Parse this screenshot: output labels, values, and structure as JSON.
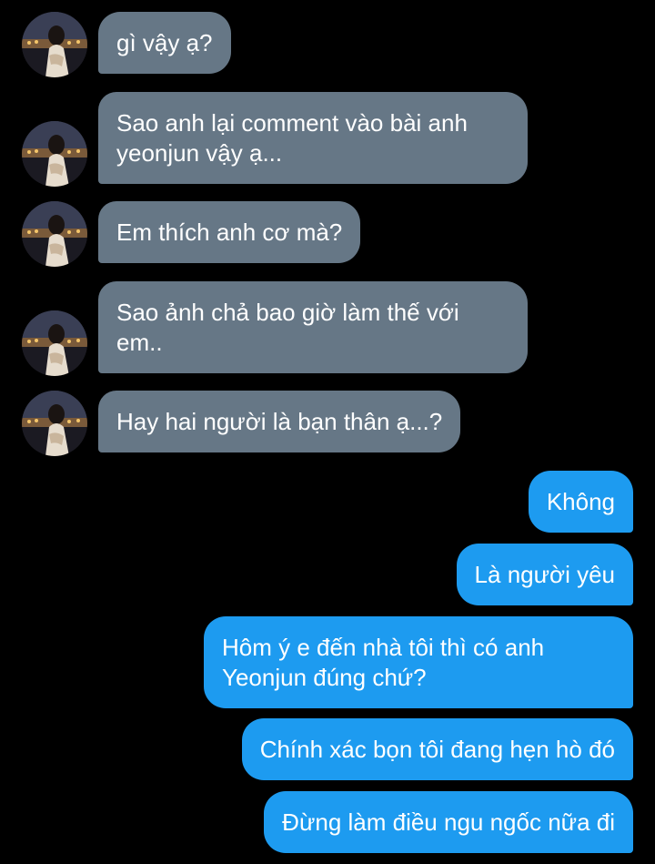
{
  "colors": {
    "background": "#000000",
    "incoming_bubble": "#667786",
    "outgoing_bubble": "#1d9bf0",
    "text": "#ffffff"
  },
  "messages": [
    {
      "direction": "incoming",
      "text": "gì vậy ạ?",
      "avatar": "avatar-photo"
    },
    {
      "direction": "incoming",
      "text": "Sao anh lại comment vào bài anh yeonjun vậy ạ...",
      "avatar": "avatar-photo"
    },
    {
      "direction": "incoming",
      "text": "Em thích anh cơ mà?",
      "avatar": "avatar-photo"
    },
    {
      "direction": "incoming",
      "text": "Sao ảnh chả bao giờ làm thế với em..",
      "avatar": "avatar-photo"
    },
    {
      "direction": "incoming",
      "text": "Hay hai người là bạn thân ạ...?",
      "avatar": "avatar-photo"
    },
    {
      "direction": "outgoing",
      "text": "Không"
    },
    {
      "direction": "outgoing",
      "text": "Là người yêu"
    },
    {
      "direction": "outgoing",
      "text": "Hôm ý e đến nhà tôi thì có anh Yeonjun đúng chứ?"
    },
    {
      "direction": "outgoing",
      "text": "Chính xác bọn tôi đang hẹn hò đó"
    },
    {
      "direction": "outgoing",
      "text": "Đừng làm điều ngu ngốc nữa đi"
    }
  ]
}
